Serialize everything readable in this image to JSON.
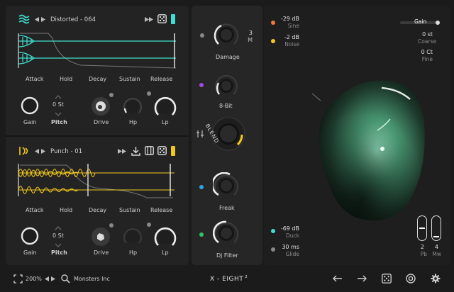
{
  "colors": {
    "teal": "#3ee0d0",
    "yellow": "#f2c81e",
    "orange": "#f07a3a",
    "purple": "#a24be0",
    "blue": "#2fa3e0",
    "green": "#2cc46a",
    "panel": "#232323"
  },
  "layer1": {
    "icon": "wave-lines-icon",
    "preset": "Distorted - 064",
    "envelope_labels": [
      "Attack",
      "Hold",
      "Decay",
      "Sustain",
      "Release"
    ],
    "pitch_value": "0 St",
    "knob_labels": {
      "gain": "Gain",
      "pitch": "Pitch",
      "drive": "Drive",
      "hp": "Hp",
      "lp": "Lp"
    }
  },
  "layer2": {
    "icon": "kick-icon",
    "preset": "Punch - 01",
    "envelope_labels": [
      "Attack",
      "Hold",
      "Decay",
      "Sustain",
      "Release"
    ],
    "pitch_value": "0 St",
    "knob_labels": {
      "gain": "Gain",
      "pitch": "Pitch",
      "drive": "Drive",
      "hp": "Hp",
      "lp": "Lp"
    }
  },
  "fx": {
    "damage": {
      "label": "Damage",
      "value": "3",
      "unit": "M"
    },
    "bitcrush": {
      "label": "8-Bit"
    },
    "blend": {
      "label": "BLEND"
    },
    "freak": {
      "label": "Freak"
    },
    "djfilter": {
      "label": "Dj Filter"
    }
  },
  "right": {
    "sine": {
      "value": "-29 dB",
      "label": "Sine"
    },
    "noise": {
      "value": "-2 dB",
      "label": "Noise"
    },
    "duck": {
      "value": "-69 dB",
      "label": "Duck"
    },
    "glide": {
      "value": "30 ms",
      "label": "Glide"
    },
    "gain_label": "Gain",
    "coarse": {
      "value": "0 st",
      "label": "Coarse"
    },
    "fine": {
      "value": "0 Ct",
      "label": "Fine"
    },
    "pb": {
      "value": "2",
      "label": "Pb"
    },
    "mw": {
      "value": "4",
      "label": "Mw"
    }
  },
  "bottom": {
    "zoom": "200%",
    "preset_bank": "Monsters Inc",
    "title": "X - EIGHT",
    "title_sup": "2"
  }
}
